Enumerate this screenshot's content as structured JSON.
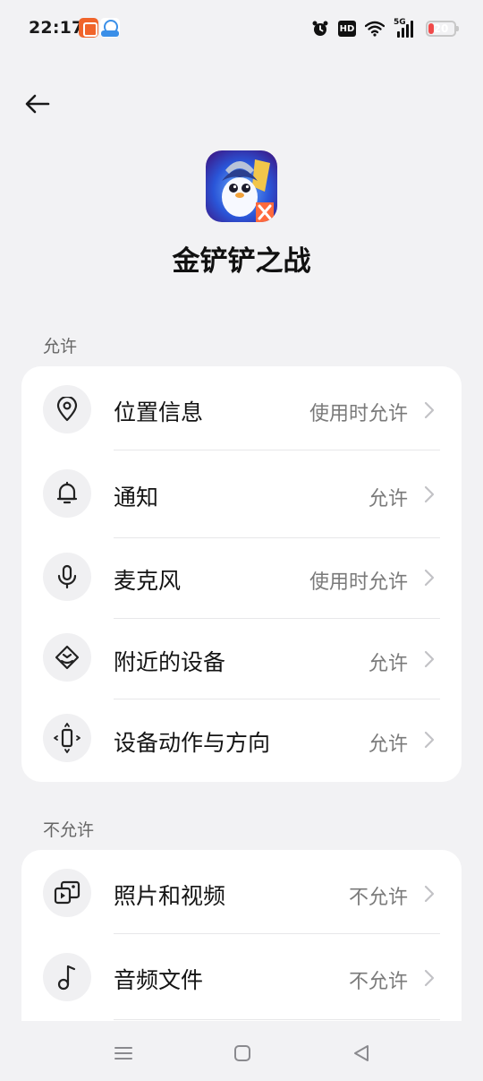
{
  "status_bar": {
    "time": "22:17",
    "hd": "HD",
    "network": "5G",
    "battery": "20",
    "battery_level": 0.2,
    "icons": [
      "notification-app-icon",
      "notification-app-icon-2",
      "alarm-icon",
      "hd-icon",
      "wifi-icon",
      "signal-icon",
      "battery-icon"
    ]
  },
  "header": {
    "back_icon": "arrow-left-icon",
    "app_name": "金铲铲之战"
  },
  "sections": {
    "allowed": {
      "label": "允许",
      "items": [
        {
          "label": "位置信息",
          "value": "使用时允许",
          "icon": "location-pin-icon"
        },
        {
          "label": "通知",
          "value": "允许",
          "icon": "bell-icon"
        },
        {
          "label": "麦克风",
          "value": "使用时允许",
          "icon": "microphone-icon"
        },
        {
          "label": "附近的设备",
          "value": "允许",
          "icon": "nearby-devices-icon"
        },
        {
          "label": "设备动作与方向",
          "value": "允许",
          "icon": "device-motion-icon"
        }
      ]
    },
    "denied": {
      "label": "不允许",
      "items": [
        {
          "label": "照片和视频",
          "value": "不允许",
          "icon": "photos-videos-icon"
        },
        {
          "label": "音频文件",
          "value": "不允许",
          "icon": "music-note-icon"
        }
      ]
    }
  },
  "nav": {
    "menu_icon": "recent-apps-icon",
    "home_icon": "home-icon",
    "back_icon": "back-triangle-icon"
  },
  "colors": {
    "background": "#f2f2f4",
    "card": "#ffffff",
    "battery_low": "#f04a4a"
  }
}
